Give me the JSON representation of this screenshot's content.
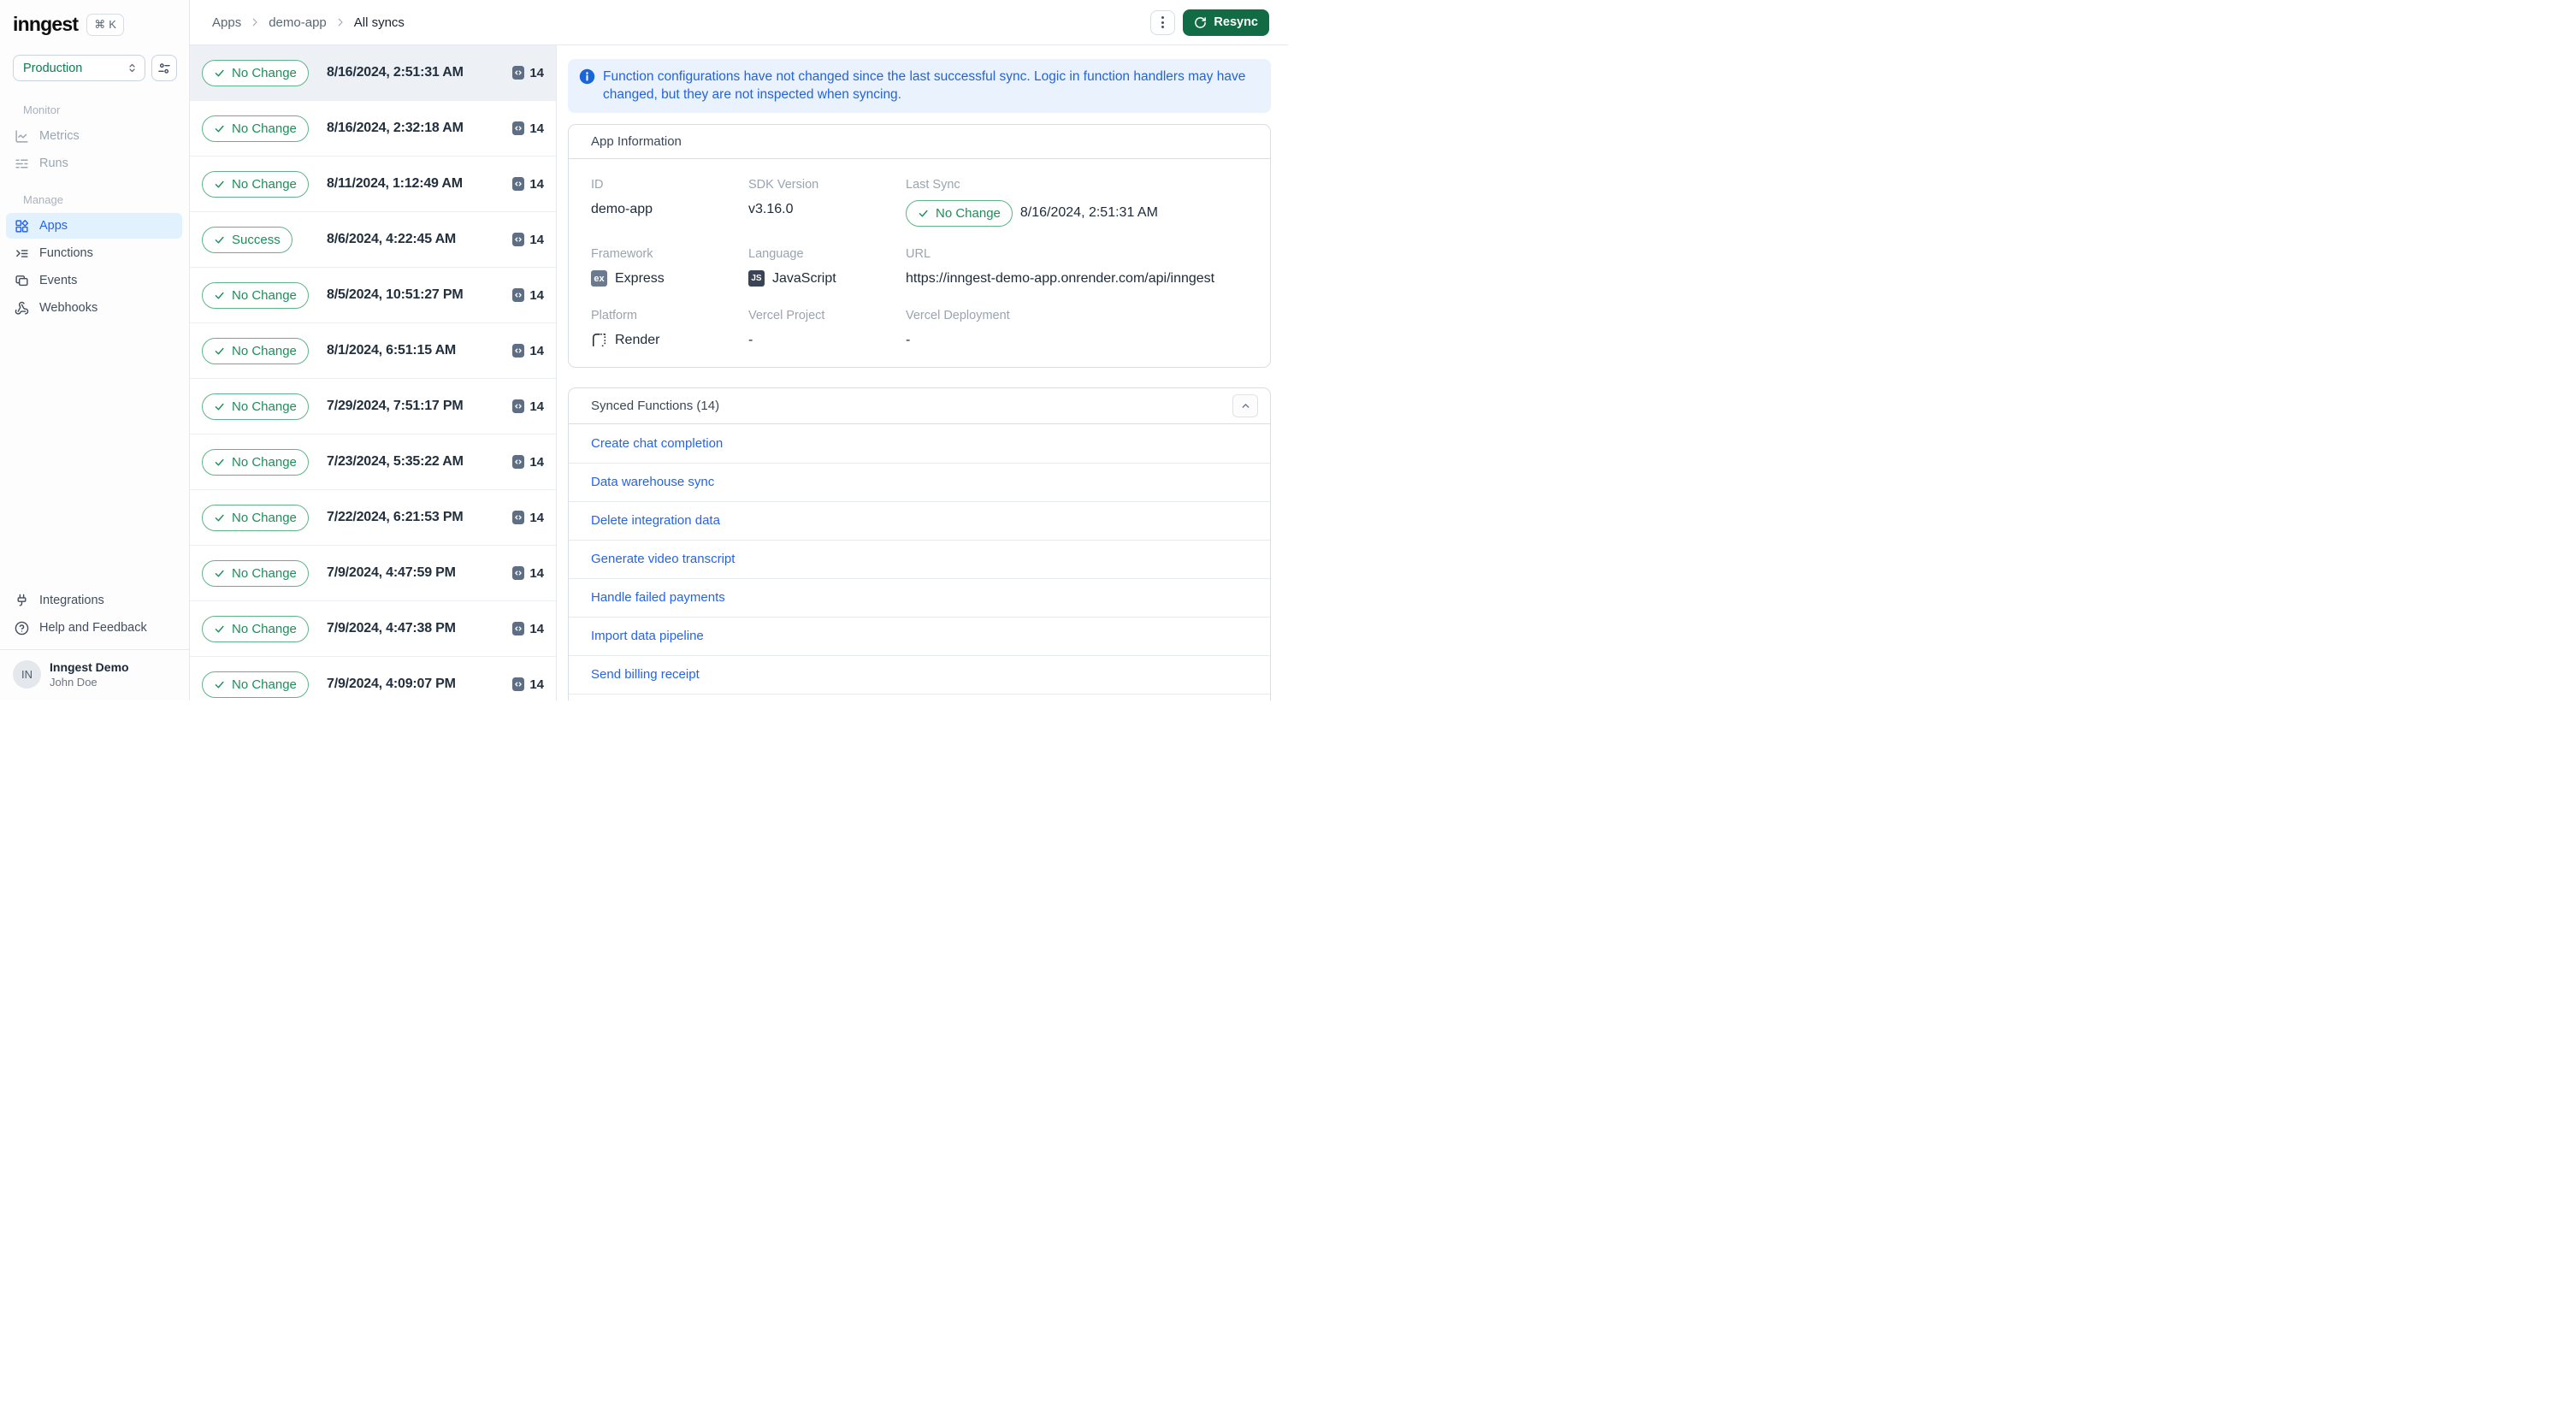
{
  "colors": {
    "brand_green": "#116C45",
    "status_green": "#1E8E5A",
    "link_blue": "#2563EB",
    "banner_blue": "#2463DB",
    "active_nav_bg": "#E2F1FE",
    "selected_row_bg": "#EDF1F6"
  },
  "sidebar": {
    "logo_text": "inngest",
    "shortcut_modifier": "⌘",
    "shortcut_key": "K",
    "environment": {
      "value": "Production"
    },
    "sections": [
      {
        "label": "Monitor",
        "items": [
          {
            "label": "Metrics",
            "icon": "metrics-icon",
            "state": "muted"
          },
          {
            "label": "Runs",
            "icon": "runs-icon",
            "state": "muted"
          }
        ]
      },
      {
        "label": "Manage",
        "items": [
          {
            "label": "Apps",
            "icon": "apps-icon",
            "state": "active"
          },
          {
            "label": "Functions",
            "icon": "functions-icon",
            "state": "default"
          },
          {
            "label": "Events",
            "icon": "events-icon",
            "state": "default"
          },
          {
            "label": "Webhooks",
            "icon": "webhooks-icon",
            "state": "default"
          }
        ]
      }
    ],
    "footer_items": [
      {
        "label": "Integrations",
        "icon": "plug-icon"
      },
      {
        "label": "Help and Feedback",
        "icon": "help-icon"
      }
    ],
    "user": {
      "initials": "IN",
      "org_name": "Inngest Demo",
      "user_name": "John Doe"
    }
  },
  "header": {
    "breadcrumb": [
      "Apps",
      "demo-app",
      "All syncs"
    ],
    "resync_label": "Resync"
  },
  "sync_list": {
    "rows": [
      {
        "status": "No Change",
        "timestamp": "8/16/2024, 2:51:31 AM",
        "count": "14",
        "selected": true
      },
      {
        "status": "No Change",
        "timestamp": "8/16/2024, 2:32:18 AM",
        "count": "14",
        "selected": false
      },
      {
        "status": "No Change",
        "timestamp": "8/11/2024, 1:12:49 AM",
        "count": "14",
        "selected": false
      },
      {
        "status": "Success",
        "timestamp": "8/6/2024, 4:22:45 AM",
        "count": "14",
        "selected": false
      },
      {
        "status": "No Change",
        "timestamp": "8/5/2024, 10:51:27 PM",
        "count": "14",
        "selected": false
      },
      {
        "status": "No Change",
        "timestamp": "8/1/2024, 6:51:15 AM",
        "count": "14",
        "selected": false
      },
      {
        "status": "No Change",
        "timestamp": "7/29/2024, 7:51:17 PM",
        "count": "14",
        "selected": false
      },
      {
        "status": "No Change",
        "timestamp": "7/23/2024, 5:35:22 AM",
        "count": "14",
        "selected": false
      },
      {
        "status": "No Change",
        "timestamp": "7/22/2024, 6:21:53 PM",
        "count": "14",
        "selected": false
      },
      {
        "status": "No Change",
        "timestamp": "7/9/2024, 4:47:59 PM",
        "count": "14",
        "selected": false
      },
      {
        "status": "No Change",
        "timestamp": "7/9/2024, 4:47:38 PM",
        "count": "14",
        "selected": false
      },
      {
        "status": "No Change",
        "timestamp": "7/9/2024, 4:09:07 PM",
        "count": "14",
        "selected": false
      }
    ]
  },
  "banner": {
    "icon": "info-icon",
    "text": "Function configurations have not changed since the last successful sync. Logic in function handlers may have changed, but they are not inspected when syncing."
  },
  "app_info": {
    "title": "App Information",
    "fields": [
      {
        "label": "ID",
        "value": "demo-app"
      },
      {
        "label": "SDK Version",
        "value": "v3.16.0"
      },
      {
        "label": "Last Sync",
        "badge": "No Change",
        "value": "8/16/2024, 2:51:31 AM"
      },
      {
        "label": "Framework",
        "value": "Express",
        "icon": "express-icon",
        "icon_text": "ex"
      },
      {
        "label": "Language",
        "value": "JavaScript",
        "icon": "javascript-icon",
        "icon_text": "JS"
      },
      {
        "label": "URL",
        "value": "https://inngest-demo-app.onrender.com/api/inngest"
      },
      {
        "label": "Platform",
        "value": "Render",
        "icon": "render-icon"
      },
      {
        "label": "Vercel Project",
        "value": "-"
      },
      {
        "label": "Vercel Deployment",
        "value": "-"
      }
    ]
  },
  "synced_functions": {
    "title": "Synced Functions (14)",
    "items": [
      "Create chat completion",
      "Data warehouse sync",
      "Delete integration data",
      "Generate video transcript",
      "Handle failed payments",
      "Import data pipeline",
      "Send billing receipt"
    ]
  }
}
